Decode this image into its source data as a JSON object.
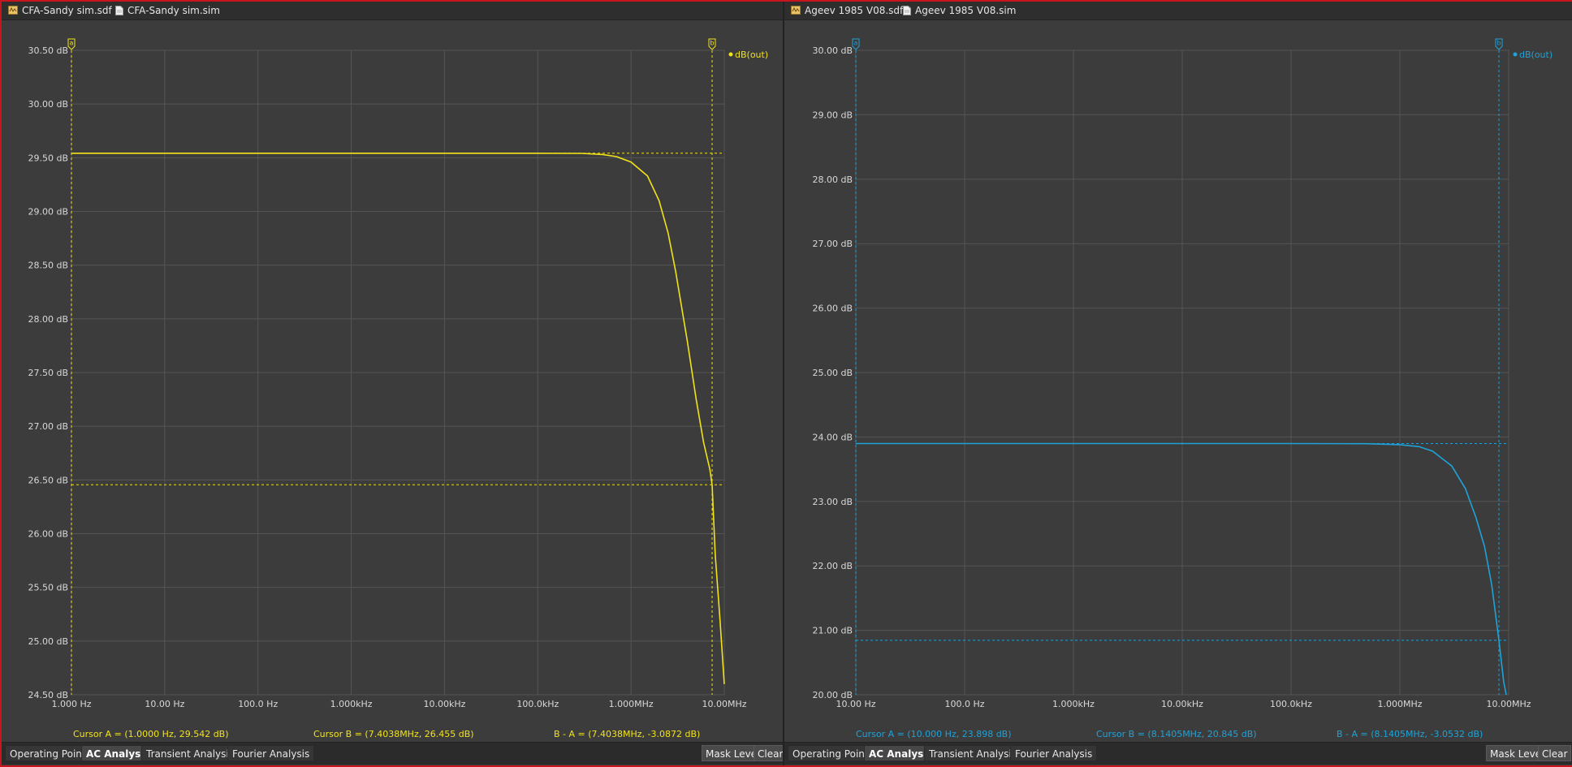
{
  "colors": {
    "left_trace": "#f2e21a",
    "right_trace": "#1fa2d8",
    "plot_bg": "#3c3c3c",
    "grid": "#555555",
    "window_border": "#c8141c"
  },
  "icons": {
    "schematic": "schematic-sheet-icon",
    "sim": "sim-file-icon"
  },
  "panes": [
    {
      "doc_tabs": {
        "schematic": "CFA-Sandy sim.sdf *",
        "sim": "CFA-Sandy sim.sim"
      },
      "cursors": {
        "a": "Cursor A = (1.0000 Hz, 29.542 dB)",
        "b": "Cursor B = (7.4038MHz, 26.455 dB)",
        "diff": "B - A = (7.4038MHz, -3.0872 dB)"
      },
      "tabs": [
        "Operating Point",
        "AC Analysis",
        "Transient Analysis",
        "Fourier Analysis"
      ],
      "active_tab": "AC Analysis",
      "buttons": {
        "mask": "Mask Level",
        "clear": "Clear"
      },
      "chart_data": {
        "type": "line",
        "x_scale": "log",
        "xlim": [
          1,
          10000000
        ],
        "ylim": [
          24.5,
          30.5
        ],
        "x_ticks": [
          "1.000 Hz",
          "10.00 Hz",
          "100.0 Hz",
          "1.000kHz",
          "10.00kHz",
          "100.0kHz",
          "1.000MHz",
          "10.00MHz"
        ],
        "y_ticks": [
          "30.50 dB",
          "30.00 dB",
          "29.50 dB",
          "29.00 dB",
          "28.50 dB",
          "28.00 dB",
          "27.50 dB",
          "27.00 dB",
          "26.50 dB",
          "26.00 dB",
          "25.50 dB",
          "25.00 dB",
          "24.50 dB"
        ],
        "grid": true,
        "legend_position": "top-right",
        "series": [
          {
            "name": "dB(out)",
            "x": [
              1,
              10,
              100,
              1000,
              10000,
              100000,
              300000,
              500000,
              700000,
              1000000,
              1500000,
              2000000,
              2500000,
              3000000,
              4000000,
              5000000,
              6000000,
              7000000,
              7403800,
              8000000,
              9000000,
              10000000
            ],
            "y": [
              29.542,
              29.542,
              29.542,
              29.542,
              29.542,
              29.542,
              29.54,
              29.53,
              29.51,
              29.46,
              29.33,
              29.1,
              28.8,
              28.45,
              27.8,
              27.25,
              26.85,
              26.6,
              26.455,
              25.8,
              25.2,
              24.6
            ]
          }
        ],
        "cursors": [
          {
            "label": "a",
            "x": 1,
            "y": 29.542
          },
          {
            "label": "b",
            "x": 7403800,
            "y": 26.455
          }
        ]
      }
    },
    {
      "doc_tabs": {
        "schematic": "Ageev 1985 V08.sdf *",
        "sim": "Ageev 1985 V08.sim"
      },
      "cursors": {
        "a": "Cursor A = (10.000 Hz, 23.898 dB)",
        "b": "Cursor B = (8.1405MHz, 20.845 dB)",
        "diff": "B - A = (8.1405MHz, -3.0532 dB)"
      },
      "tabs": [
        "Operating Point",
        "AC Analysis",
        "Transient Analysis",
        "Fourier Analysis"
      ],
      "active_tab": "AC Analysis",
      "buttons": {
        "mask": "Mask Level",
        "clear": "Clear"
      },
      "chart_data": {
        "type": "line",
        "x_scale": "log",
        "xlim": [
          10,
          10000000
        ],
        "ylim": [
          20,
          30
        ],
        "x_ticks": [
          "10.00 Hz",
          "100.0 Hz",
          "1.000kHz",
          "10.00kHz",
          "100.0kHz",
          "1.000MHz",
          "10.00MHz"
        ],
        "y_ticks": [
          "30.00 dB",
          "29.00 dB",
          "28.00 dB",
          "27.00 dB",
          "26.00 dB",
          "25.00 dB",
          "24.00 dB",
          "23.00 dB",
          "22.00 dB",
          "21.00 dB",
          "20.00 dB"
        ],
        "grid": true,
        "legend_position": "top-right",
        "series": [
          {
            "name": "dB(out)",
            "x": [
              10,
              100,
              1000,
              10000,
              100000,
              500000,
              1000000,
              1500000,
              2000000,
              3000000,
              4000000,
              5000000,
              6000000,
              7000000,
              8140500,
              9000000,
              9500000
            ],
            "y": [
              23.898,
              23.898,
              23.898,
              23.898,
              23.898,
              23.895,
              23.88,
              23.85,
              23.78,
              23.55,
              23.2,
              22.75,
              22.3,
              21.7,
              20.845,
              20.2,
              20.0
            ]
          }
        ],
        "cursors": [
          {
            "label": "a",
            "x": 10,
            "y": 23.898
          },
          {
            "label": "b",
            "x": 8140500,
            "y": 20.845
          }
        ]
      }
    }
  ]
}
